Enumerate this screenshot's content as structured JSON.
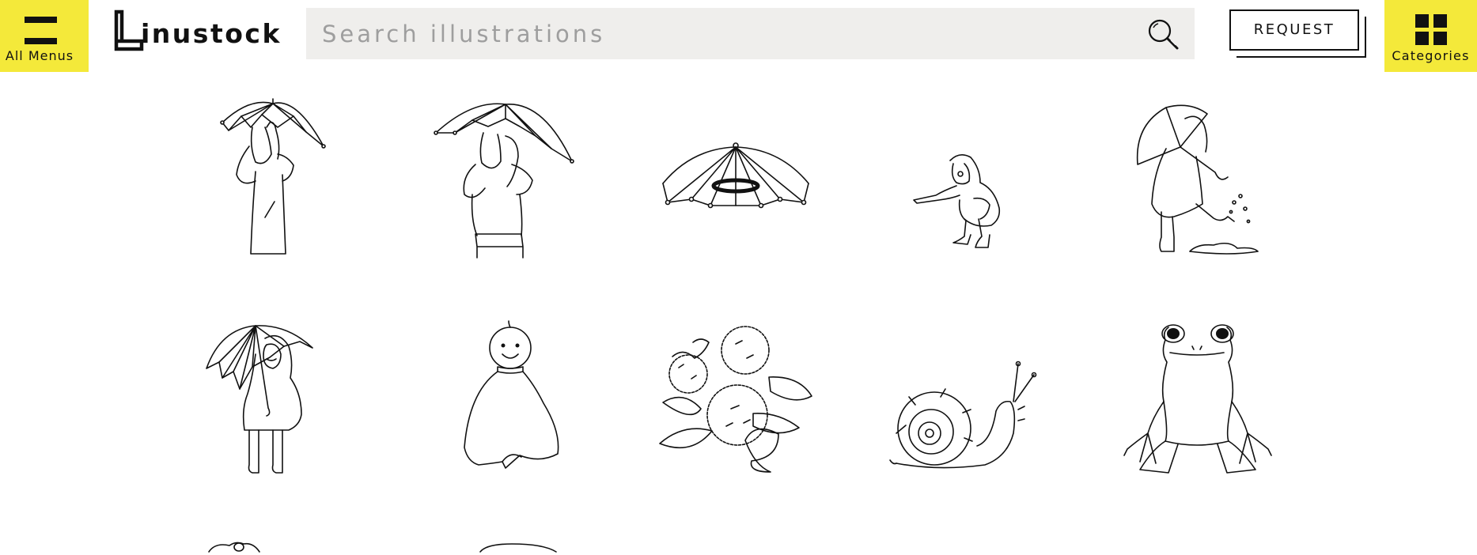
{
  "header": {
    "menu_label": "All Menus",
    "logo_text": "inustock",
    "search_placeholder": "Search illustrations",
    "request_label": "REQUEST",
    "categories_label": "Categories"
  },
  "colors": {
    "accent": "#f4e93a",
    "search_bg": "#efeeec",
    "ink": "#111111"
  },
  "illustrations": [
    {
      "subject": "person-under-umbrella-covering-face"
    },
    {
      "subject": "woman-under-umbrella-covering-face"
    },
    {
      "subject": "umbrella-hat"
    },
    {
      "subject": "child-in-raincoat-crouching-pointing"
    },
    {
      "subject": "child-in-raincoat-splashing-puddle"
    },
    {
      "subject": "child-in-raincoat-holding-umbrella"
    },
    {
      "subject": "teru-teru-bozu-doll"
    },
    {
      "subject": "hydrangea-flowers"
    },
    {
      "subject": "snail"
    },
    {
      "subject": "frog"
    },
    {
      "subject": "frog-partial"
    },
    {
      "subject": "partial-illustration"
    }
  ]
}
